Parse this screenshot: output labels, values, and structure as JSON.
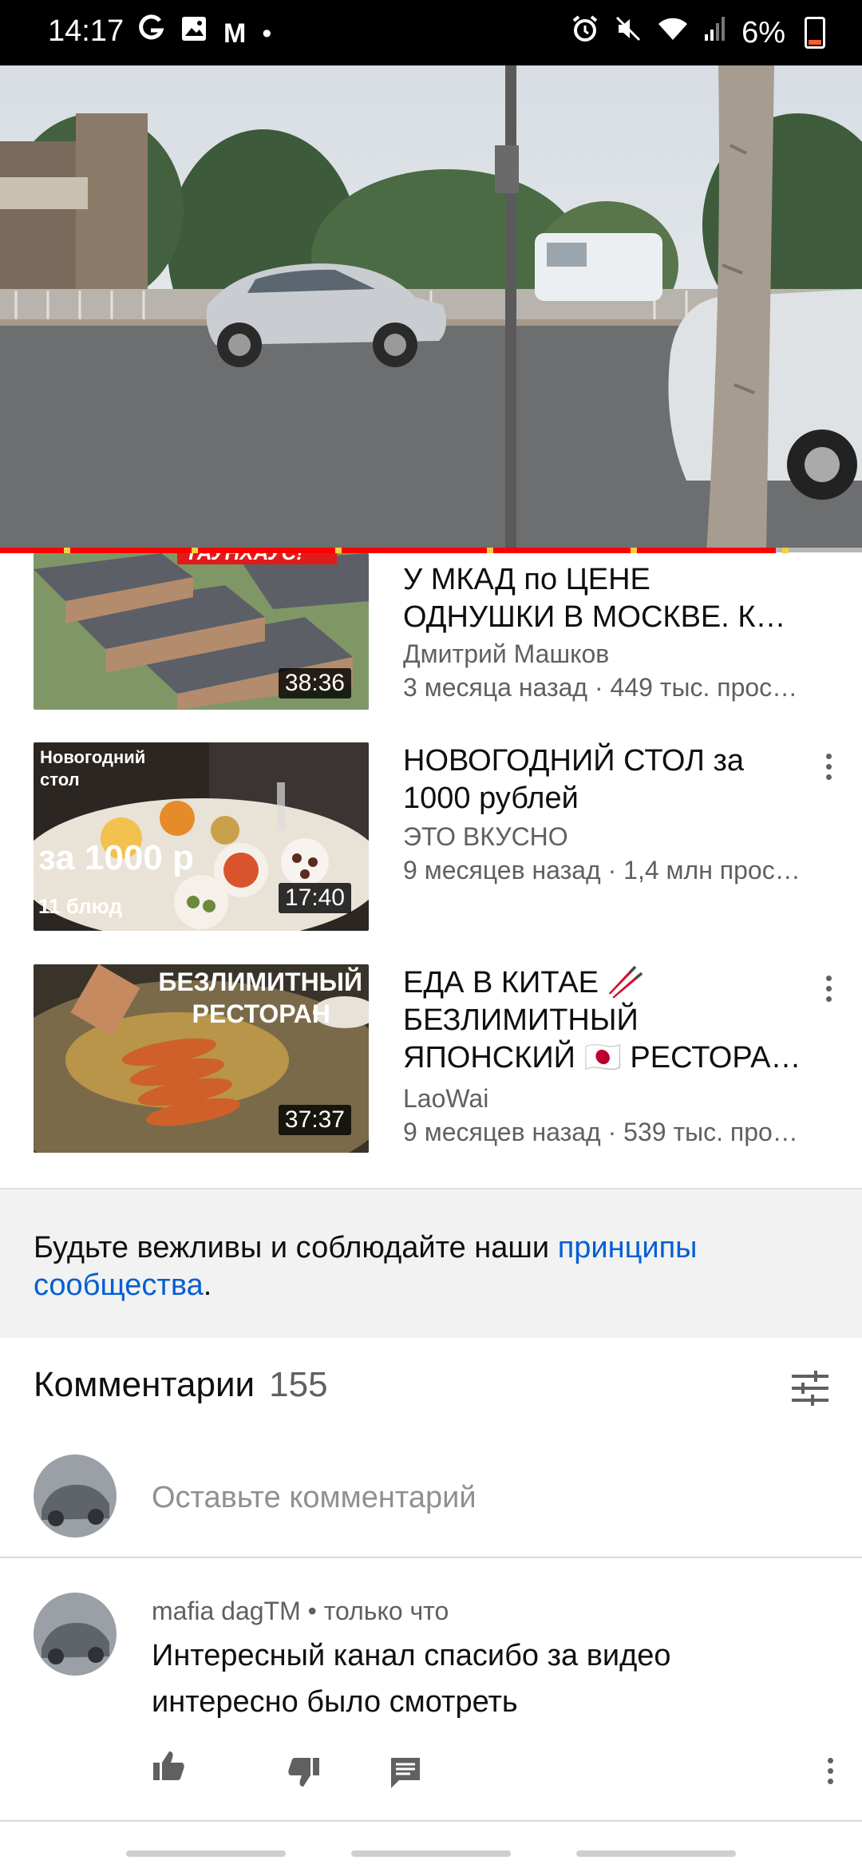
{
  "status_bar": {
    "time": "14:17",
    "left_icons": [
      "google-icon",
      "gallery-icon",
      "gmail-icon",
      "dot-icon"
    ],
    "right_icons": [
      "alarm-icon",
      "mute-icon",
      "wifi-icon",
      "signal-icon"
    ],
    "battery": "6%"
  },
  "player": {
    "progress_fraction": 0.9
  },
  "recommendations": [
    {
      "title": "У МКАД по ЦЕНЕ ОДНУШКИ В МОСКВЕ. К…",
      "channel": "Дмитрий Машков",
      "meta": "3 месяца назад · 449 тыс. прос…",
      "duration": "38:36"
    },
    {
      "title": "НОВОГОДНИЙ СТОЛ за 1000 рублей",
      "channel": "ЭТО ВКУСНО",
      "meta": "9 месяцев назад · 1,4 млн прос…",
      "duration": "17:40",
      "thumb_text": [
        "Новогодний",
        "стол",
        "за 1000 р",
        "11 блюд"
      ]
    },
    {
      "title": "ЕДА В КИТАЕ 🥢 БЕЗЛИМИТНЫЙ ЯПОНСКИЙ 🇯🇵 РЕСТОРА…",
      "channel": "LaoWai",
      "meta": "9 месяцев назад · 539 тыс. про…",
      "duration": "37:37",
      "thumb_text": [
        "БЕЗЛИМИТНЫЙ",
        "РЕСТОРАН"
      ]
    }
  ],
  "first_thumb_banner": "ТАУНХАУС!",
  "notice": {
    "text": "Будьте вежливы и соблюдайте наши ",
    "link": "принципы сообщества",
    "end": "."
  },
  "comments": {
    "label": "Комментарии",
    "count": "155",
    "placeholder": "Оставьте комментарий",
    "items": [
      {
        "author": "mafia dagTM",
        "time": "только что",
        "text": "Интересный канал спасибо за видео интересно было смотреть"
      }
    ]
  },
  "colors": {
    "accent_red": "#ff0000",
    "link_blue": "#065fd4",
    "secondary_text": "#606060"
  }
}
